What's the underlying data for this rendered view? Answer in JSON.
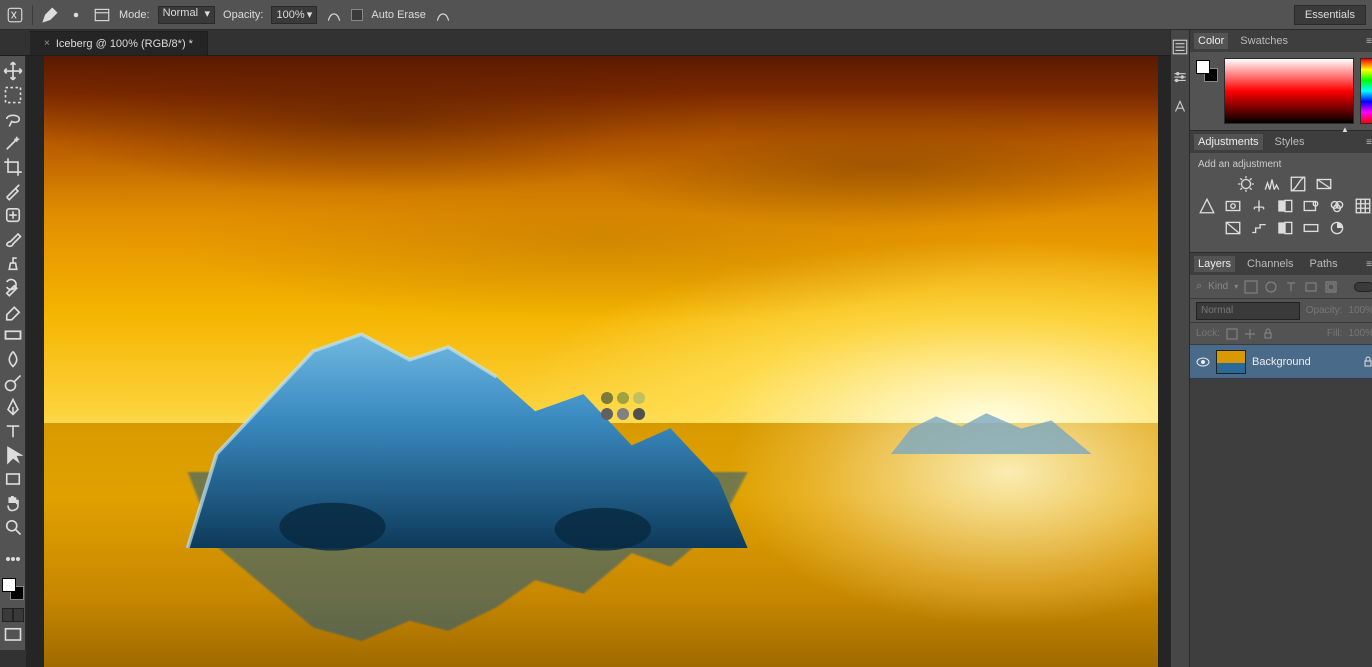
{
  "options_bar": {
    "mode_label": "Mode:",
    "mode_value": "Normal",
    "opacity_label": "Opacity:",
    "opacity_value": "100%",
    "auto_erase_label": "Auto Erase",
    "workspace": "Essentials"
  },
  "document_tab": {
    "title": "Iceberg @ 100% (RGB/8*) *"
  },
  "tools": [
    "move-tool",
    "marquee-tool",
    "lasso-tool",
    "magic-wand-tool",
    "crop-tool",
    "eyedropper-tool",
    "spot-healing-tool",
    "brush-tool",
    "clone-stamp-tool",
    "history-brush-tool",
    "eraser-tool",
    "gradient-tool",
    "blur-tool",
    "dodge-tool",
    "pen-tool",
    "type-tool",
    "path-select-tool",
    "rectangle-tool",
    "hand-tool",
    "zoom-tool"
  ],
  "color_sampler_dots": [
    "#7a7a3a",
    "#a0a040",
    "#c0c060",
    "#606060",
    "#808080",
    "#505050"
  ],
  "panels": {
    "color": {
      "tabs": [
        "Color",
        "Swatches"
      ],
      "active": "Color"
    },
    "adjustments": {
      "tabs": [
        "Adjustments",
        "Styles"
      ],
      "active": "Adjustments",
      "heading": "Add an adjustment"
    },
    "layers": {
      "tabs": [
        "Layers",
        "Channels",
        "Paths"
      ],
      "active": "Layers",
      "filter_label": "Kind",
      "blend_mode": "Normal",
      "opacity_label": "Opacity:",
      "opacity_value": "100%",
      "lock_label": "Lock:",
      "fill_label": "Fill:",
      "fill_value": "100%",
      "items": [
        {
          "name": "Background",
          "visible": true,
          "locked": true
        }
      ]
    }
  }
}
